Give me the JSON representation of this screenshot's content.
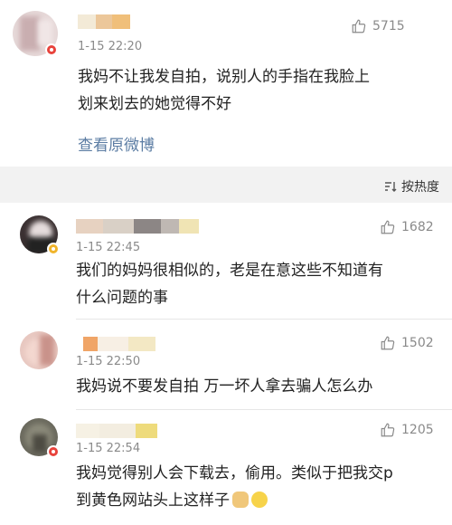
{
  "post": {
    "time": "1-15 22:20",
    "likes": "5715",
    "text_line1": "我妈不让我发自拍，说别人的手指在我脸上",
    "text_line2": "划来划去的她觉得不好",
    "view_original": "查看原微博"
  },
  "sort": {
    "label": "按热度"
  },
  "comments": [
    {
      "time": "1-15 22:45",
      "likes": "1682",
      "line1": "我们的妈妈很相似的，老是在意这些不知道有",
      "line2": "什么问题的事"
    },
    {
      "time": "1-15 22:50",
      "likes": "1502",
      "line1": "我妈说不要发自拍 万一坏人拿去骗人怎么办"
    },
    {
      "time": "1-15 22:54",
      "likes": "1205",
      "line1": "我妈觉得别人会下载去，偷用。类似于把我交p",
      "line2": "到黄色网站头上这样子"
    }
  ],
  "colors": {
    "link": "#5b7ca3",
    "badge": "#e8433c",
    "muted": "#8a8a8a"
  }
}
